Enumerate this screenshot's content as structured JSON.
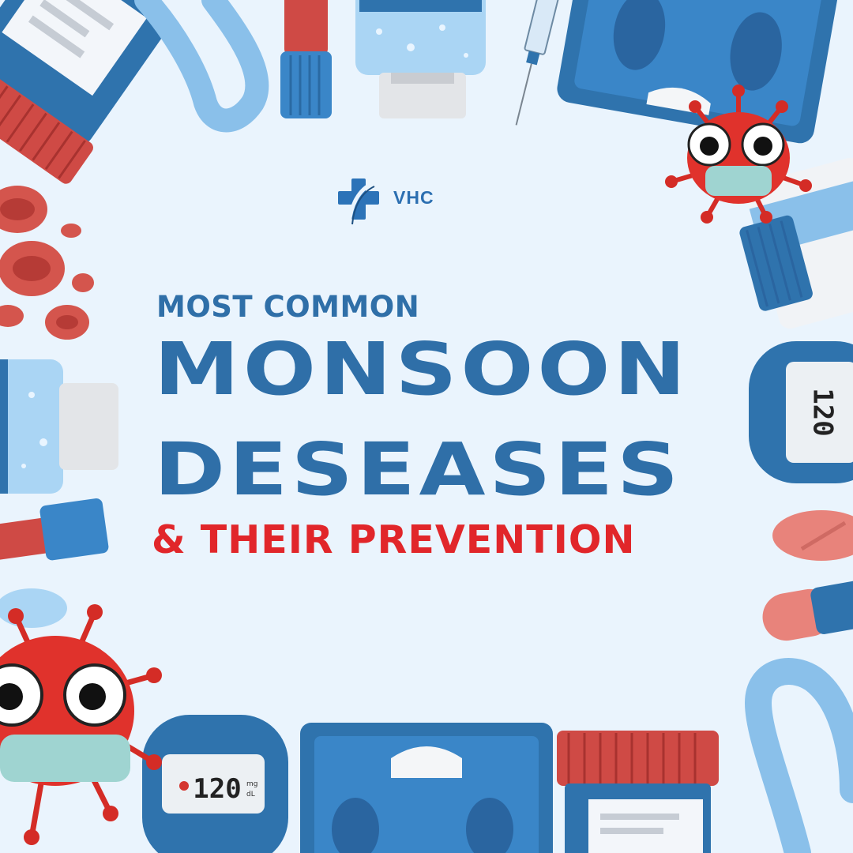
{
  "logo": {
    "text": "VHC",
    "icon": "medical-cross-icon"
  },
  "headline": {
    "line1": "MOST COMMON",
    "line2": "MONSOON",
    "line3": "DESEASES",
    "line4": "& THEIR PREVENTION"
  },
  "colors": {
    "background": "#eaf4fd",
    "primary_blue": "#2f6fa8",
    "accent_red": "#e1262a",
    "light_blue": "#8fc3ee"
  },
  "decor": {
    "meter_reading": "120",
    "meter_unit_top": "mg",
    "meter_unit_bottom": "dL"
  }
}
